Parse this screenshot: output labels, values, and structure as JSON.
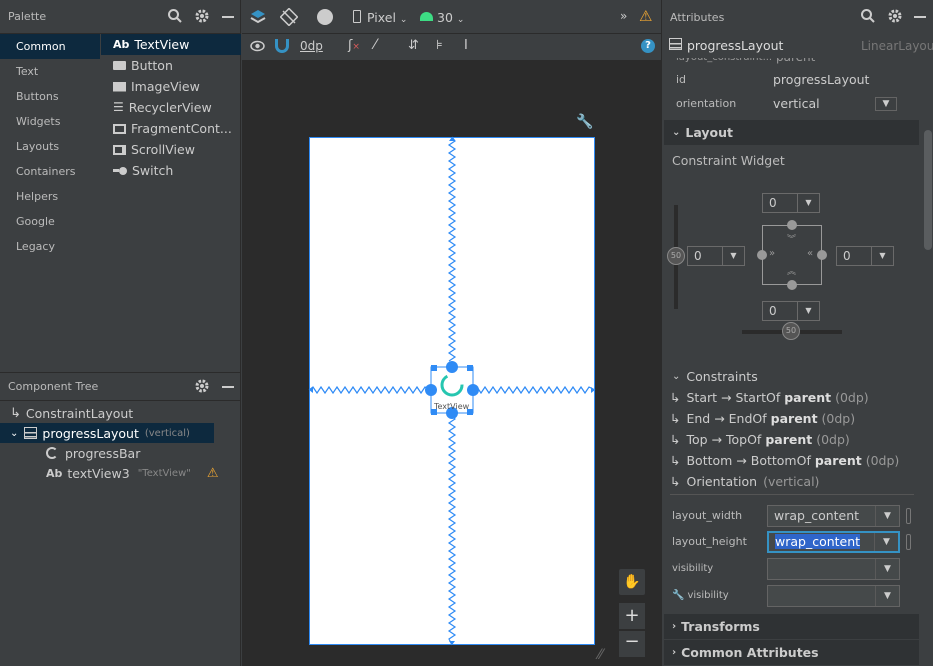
{
  "palette": {
    "title": "Palette",
    "categories": [
      "Common",
      "Text",
      "Buttons",
      "Widgets",
      "Layouts",
      "Containers",
      "Helpers",
      "Google",
      "Legacy"
    ],
    "items": [
      {
        "icon": "Ab",
        "label": "TextView"
      },
      {
        "icon": "btn",
        "label": "Button"
      },
      {
        "icon": "img",
        "label": "ImageView"
      },
      {
        "icon": "list",
        "label": "RecyclerView"
      },
      {
        "icon": "frag",
        "label": "FragmentCont..."
      },
      {
        "icon": "scroll",
        "label": "ScrollView"
      },
      {
        "icon": "switch",
        "label": "Switch"
      }
    ]
  },
  "component_tree": {
    "title": "Component Tree",
    "rows": [
      {
        "label": "ConstraintLayout",
        "extra": ""
      },
      {
        "label": "progressLayout",
        "extra": "(vertical)"
      },
      {
        "label": "progressBar",
        "extra": ""
      },
      {
        "label": "textView3",
        "extra": "\"TextView\""
      }
    ]
  },
  "toolbar": {
    "device": "Pixel",
    "api": "30",
    "margin": "0dp"
  },
  "canvas": {
    "textview_label": "TextView"
  },
  "attributes": {
    "title": "Attributes",
    "component_name": "progressLayout",
    "component_type": "LinearLayout",
    "clipped_row_key": "layout_constraint...",
    "clipped_row_value": "parent",
    "id_key": "id",
    "id_value": "progressLayout",
    "orientation_key": "orientation",
    "orientation_value": "vertical",
    "layout_section": "Layout",
    "constraint_widget": "Constraint Widget",
    "margin_top": "0",
    "margin_bottom": "0",
    "margin_start": "0",
    "margin_end": "0",
    "bias_v": "50",
    "bias_h": "50",
    "constraints_title": "Constraints",
    "constraints": [
      {
        "a": "Start → StartOf ",
        "b": "parent",
        "c": " (0dp)"
      },
      {
        "a": "End → EndOf ",
        "b": "parent",
        "c": " (0dp)"
      },
      {
        "a": "Top → TopOf ",
        "b": "parent",
        "c": " (0dp)"
      },
      {
        "a": "Bottom → BottomOf ",
        "b": "parent",
        "c": " (0dp)"
      }
    ],
    "orientation_constraint": "Orientation",
    "orientation_constraint_value": "(vertical)",
    "layout_width_key": "layout_width",
    "layout_width_value": "wrap_content",
    "layout_height_key": "layout_height",
    "layout_height_value": "wrap_content",
    "visibility_key": "visibility",
    "visibility_value": "",
    "tools_visibility_key": "visibility",
    "tools_visibility_value": "",
    "transforms_section": "Transforms",
    "common_section": "Common Attributes"
  },
  "colors": {
    "selection": "#0d293e",
    "accent": "#2f8bf5",
    "warning": "#f0a732",
    "android_green": "#3ddc84"
  }
}
